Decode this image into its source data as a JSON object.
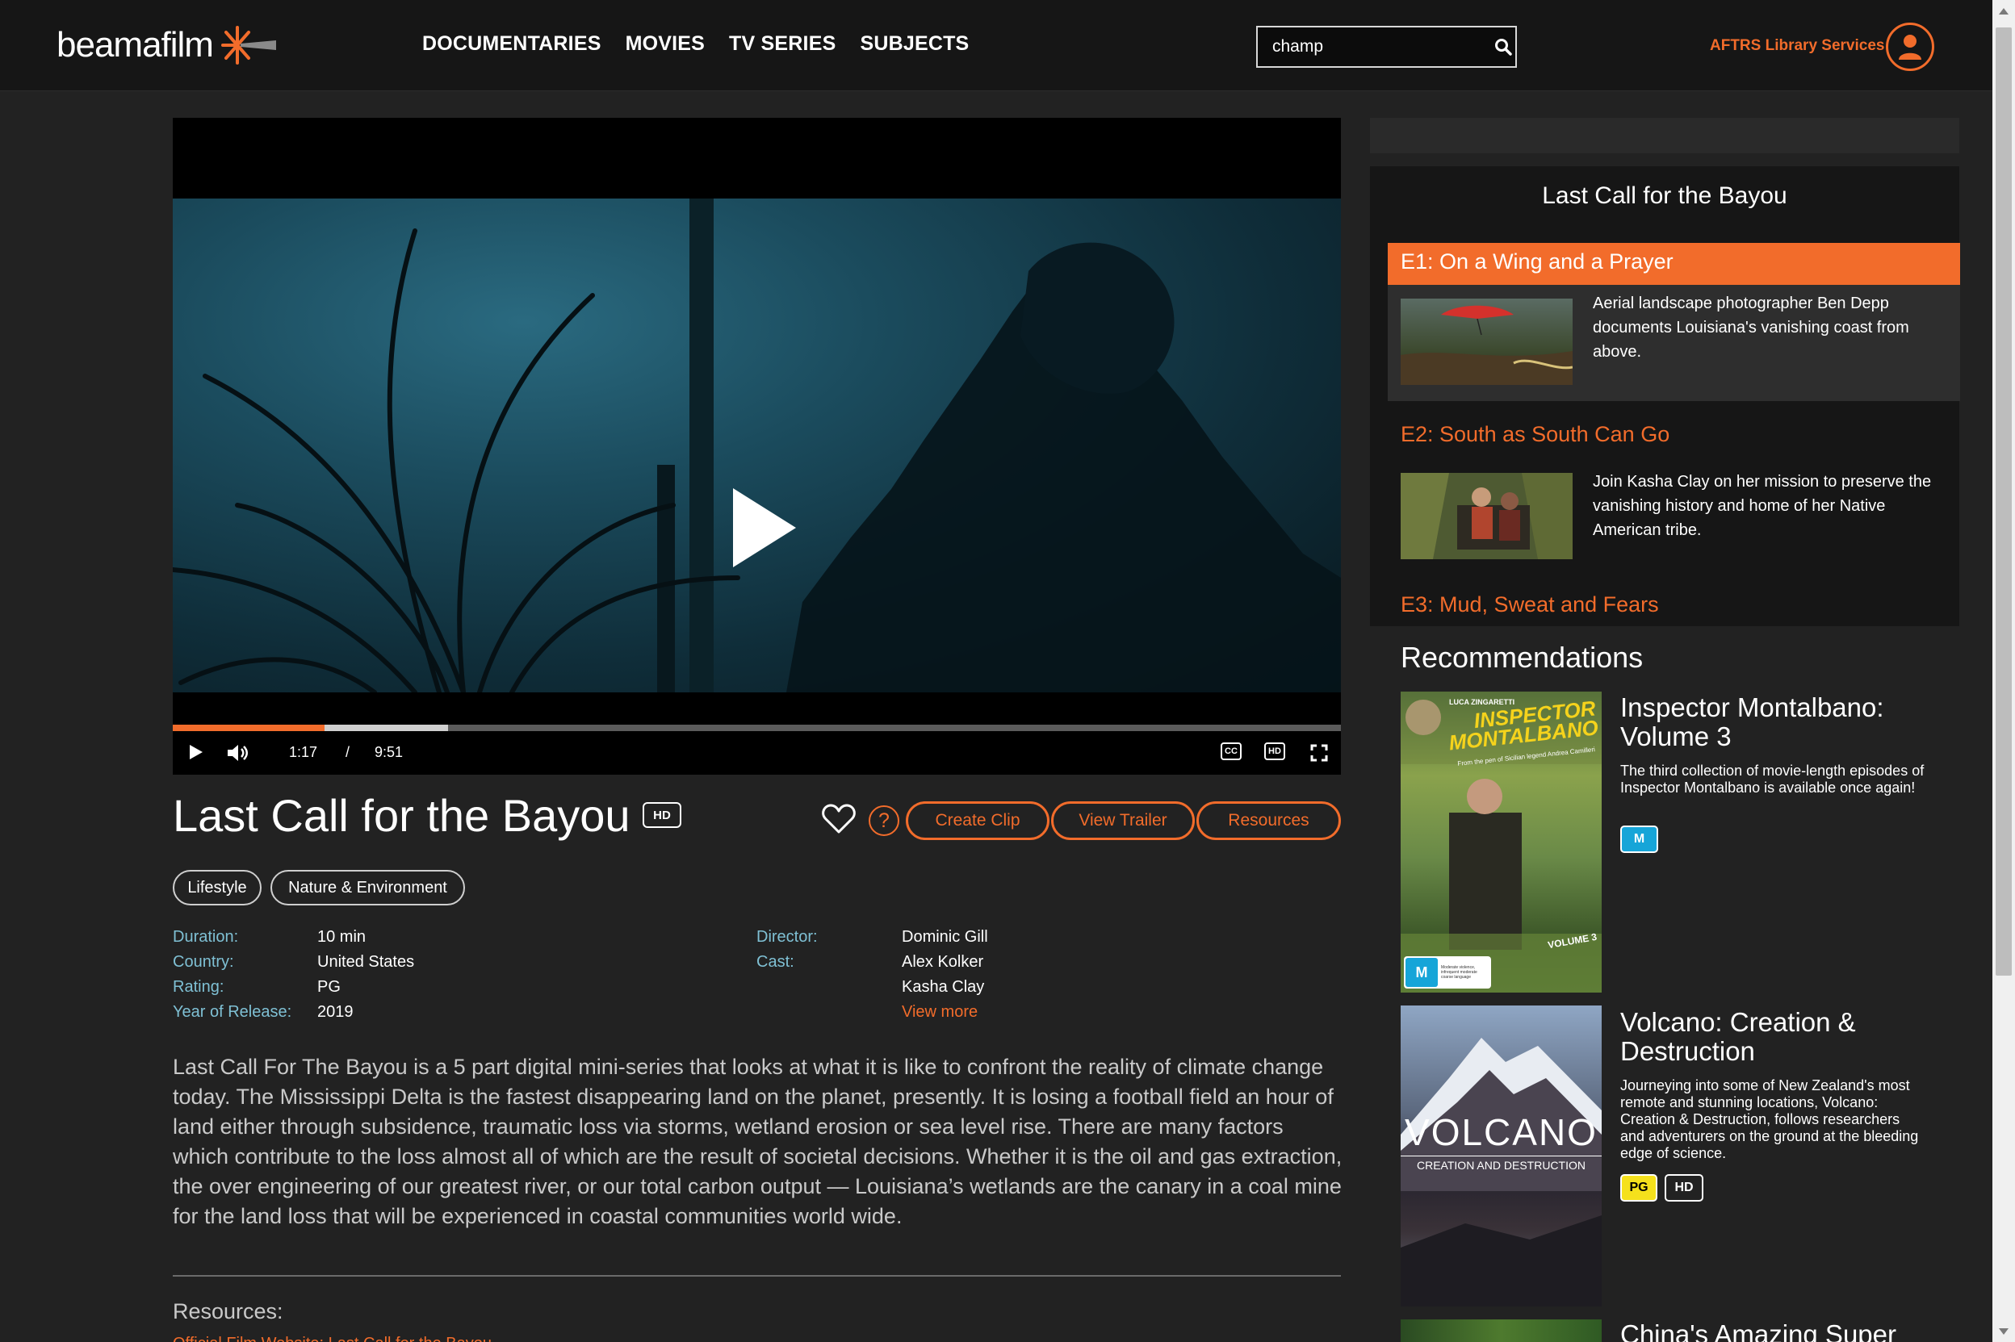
{
  "header": {
    "logo_text": "beamafilm",
    "nav": [
      "DOCUMENTARIES",
      "MOVIES",
      "TV SERIES",
      "SUBJECTS"
    ],
    "search_value": "champ",
    "account_name": "AFTRS Library Services"
  },
  "player": {
    "current_time": "1:17",
    "separator": "/",
    "duration": "9:51",
    "played_fraction": 0.13,
    "buffered_fraction": 0.236,
    "cc_label": "CC",
    "hd_label": "HD"
  },
  "film": {
    "title": "Last Call for the Bayou",
    "hd_badge": "HD",
    "help_label": "?",
    "actions": [
      "Create Clip",
      "View Trailer",
      "Resources"
    ],
    "tags": [
      "Lifestyle",
      "Nature & Environment"
    ],
    "meta_left": [
      {
        "label": "Duration:",
        "value": "10 min"
      },
      {
        "label": "Country:",
        "value": "United States"
      },
      {
        "label": "Rating:",
        "value": "PG"
      },
      {
        "label": "Year of Release:",
        "value": "2019"
      }
    ],
    "director_label": "Director:",
    "director": "Dominic Gill",
    "cast_label": "Cast:",
    "cast": [
      "Alex Kolker",
      "Kasha Clay"
    ],
    "view_more": "View more",
    "description": "Last Call For The Bayou is a 5 part digital mini-series that looks at what it is like to confront the reality of climate change today. The Mississippi Delta is the fastest disappearing land on the planet, presently. It is losing a football field an hour of land either through subsidence, traumatic loss via storms, wetland erosion or sea level rise. There are many factors which contribute to the loss almost all of which are the result of societal decisions. Whether it is the oil and gas extraction, the over engineering of our greatest river, or our total carbon output — Louisiana’s wetlands are the canary in a coal mine for the land loss that will be experienced in coastal communities world wide.",
    "resources_label": "Resources:",
    "resources_link": "Official Film Website: Last Call for the Bayou"
  },
  "episodes": {
    "series_title": "Last Call for the Bayou",
    "items": [
      {
        "title": "E1: On a Wing and a Prayer",
        "description": "Aerial landscape photographer Ben Depp documents Louisiana's vanishing coast from above."
      },
      {
        "title": "E2: South as South Can Go",
        "description": "Join Kasha Clay on her mission to preserve the vanishing history and home of her Native American tribe."
      },
      {
        "title": "E3: Mud, Sweat and Fears",
        "description": ""
      }
    ]
  },
  "recommendations": {
    "heading": "Recommendations",
    "items": [
      {
        "title": "Inspector Montalbano: Volume 3",
        "description": "The third collection of movie-length episodes of Inspector Montalbano is available once again!",
        "badges": [
          "M"
        ],
        "poster": {
          "top_small": "LUCA ZINGARETTI",
          "main": "INSPECTOR MONTALBANO",
          "sub": "From the pen of Sicilian legend Andrea Camilleri",
          "volume": "VOLUME 3",
          "rating": "M",
          "rating_note": "Moderate violence, infrequent moderate coarse language"
        }
      },
      {
        "title": "Volcano: Creation & Destruction",
        "description": "Journeying into some of New Zealand's most remote and stunning locations, Volcano: Creation & Destruction, follows researchers and adventurers on the ground at the bleeding edge of science.",
        "badges": [
          "PG",
          "HD"
        ],
        "poster": {
          "main": "VOLCANO",
          "sub": "CREATION AND DESTRUCTION"
        }
      },
      {
        "title": "China's Amazing Super",
        "description": "",
        "badges": []
      }
    ]
  },
  "colors": {
    "accent": "#f26c2b",
    "meta_label": "#7fc0d4",
    "rating_m": "#16a5d8",
    "rating_pg": "#f5e11c"
  }
}
